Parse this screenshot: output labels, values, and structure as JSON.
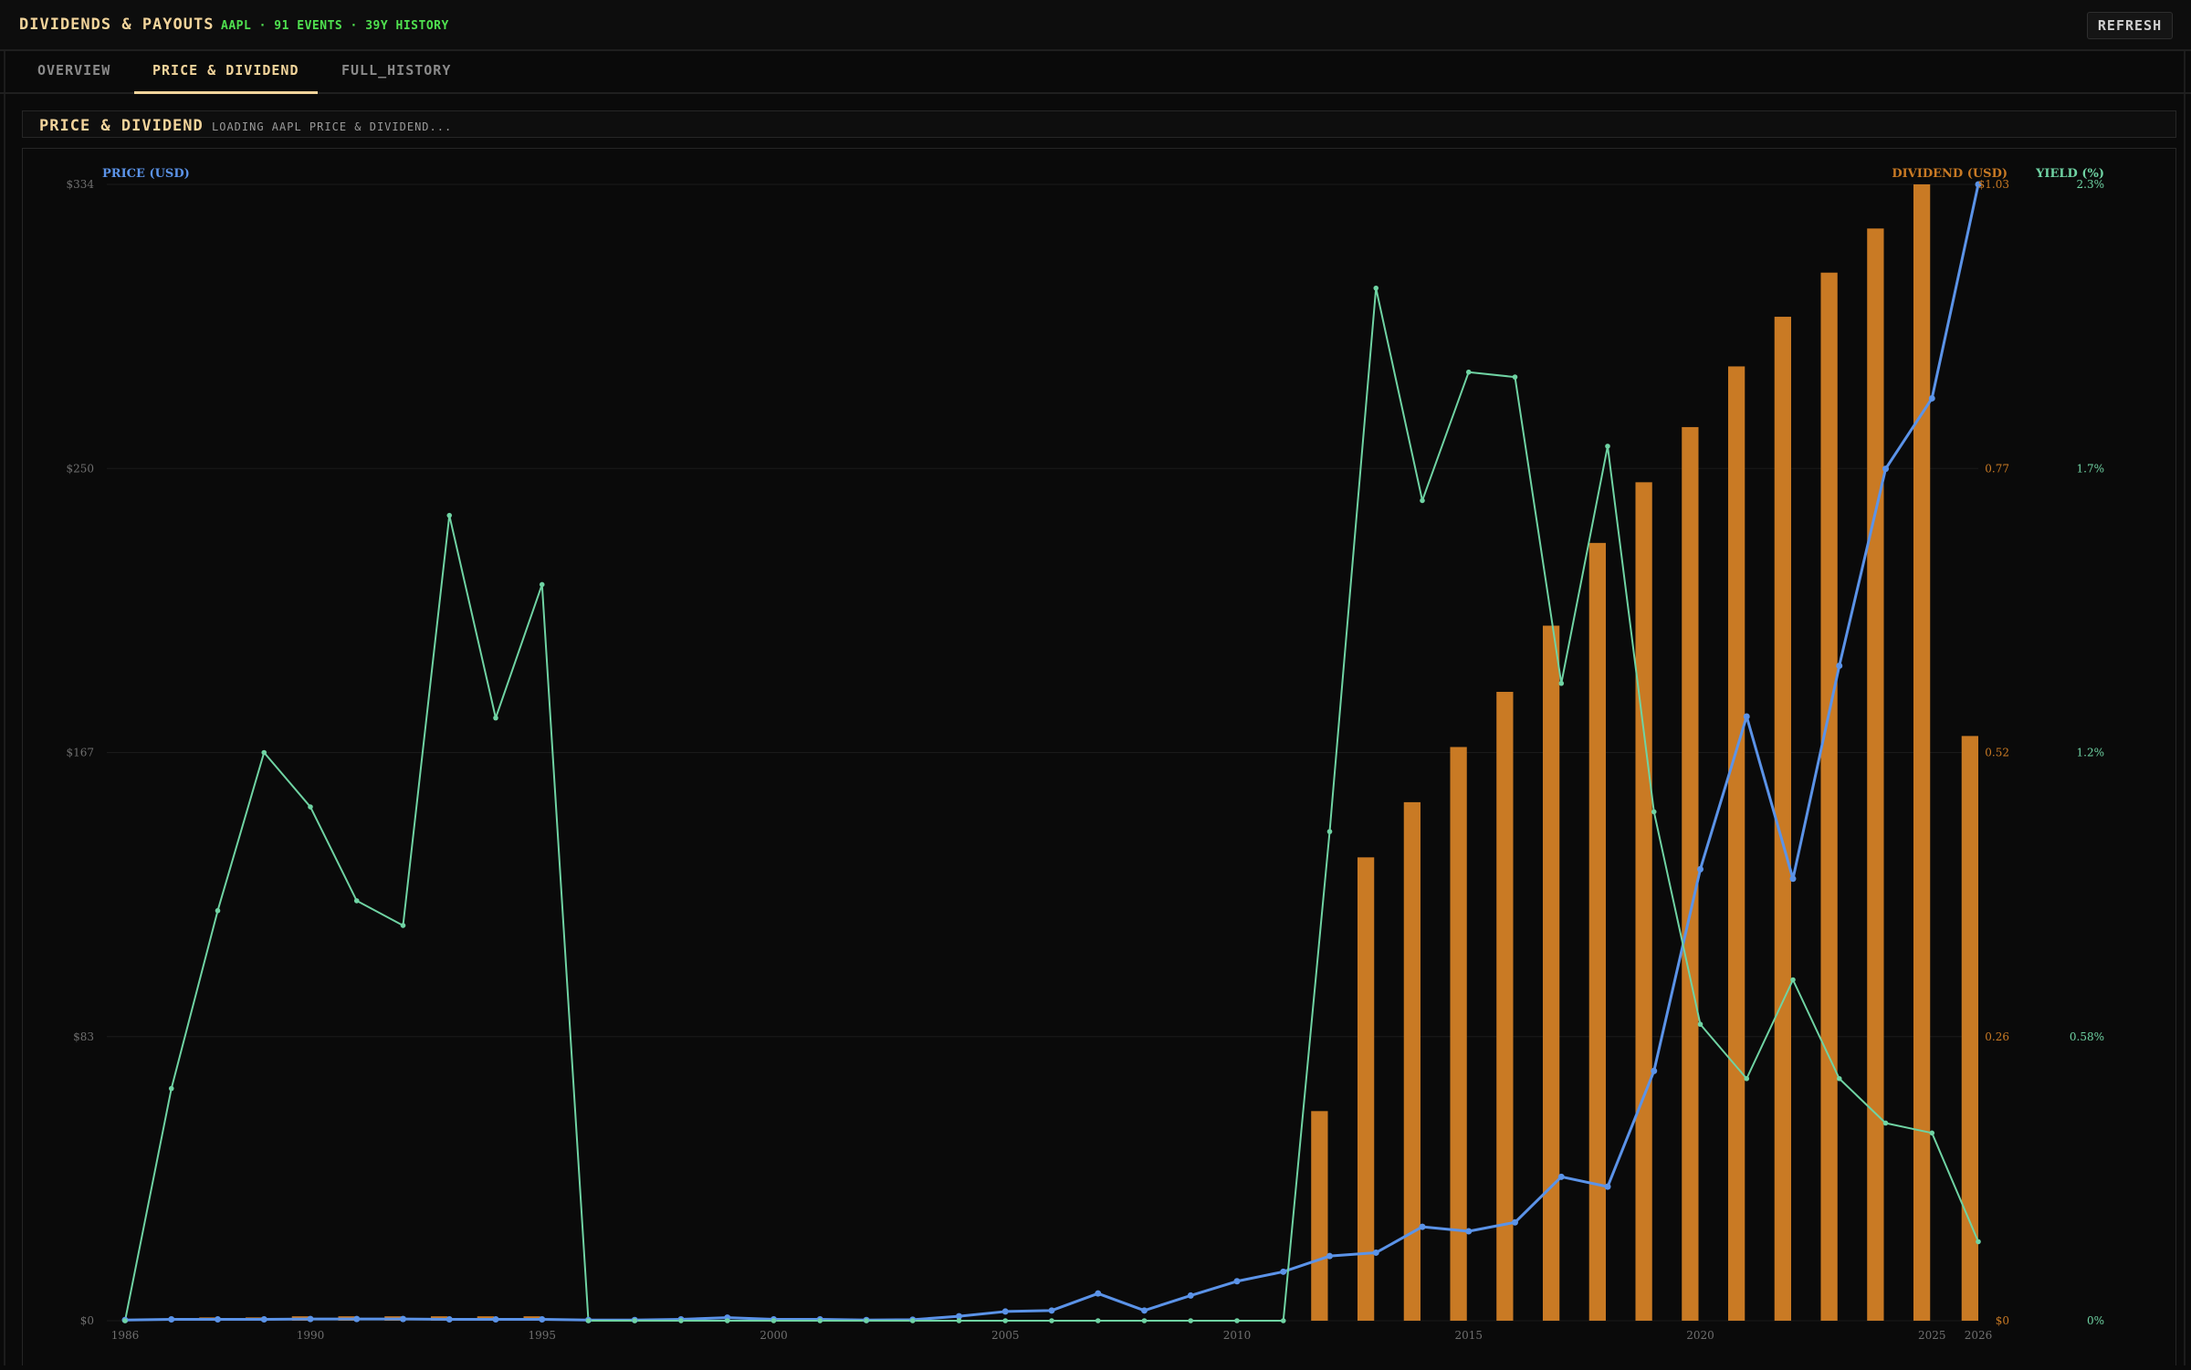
{
  "header": {
    "title": "DIVIDENDS & PAYOUTS",
    "meta": "AAPL · 91 EVENTS · 39Y HISTORY",
    "refresh_label": "REFRESH"
  },
  "tabs": [
    {
      "label": "OVERVIEW",
      "active": false
    },
    {
      "label": "PRICE & DIVIDEND",
      "active": true
    },
    {
      "label": "FULL_HISTORY",
      "active": false
    }
  ],
  "section": {
    "title": "PRICE & DIVIDEND",
    "status": "LOADING AAPL PRICE & DIVIDEND..."
  },
  "colors": {
    "price": "#5b93e8",
    "dividend": "#c97a24",
    "yield": "#6fd3a3",
    "accent": "#f2d49b",
    "meta_green": "#4fe04f"
  },
  "chart_data": {
    "type": "bar+line",
    "axes": {
      "price": {
        "label": "PRICE (USD)",
        "ticks": [
          "$0",
          "$83",
          "$167",
          "$250",
          "$334"
        ],
        "range": [
          0,
          334
        ]
      },
      "dividend": {
        "label": "DIVIDEND (USD)",
        "ticks": [
          "$0",
          "0.26",
          "0.52",
          "0.77",
          "$1.03"
        ],
        "range": [
          0,
          1.03
        ]
      },
      "yield": {
        "label": "YIELD (%)",
        "ticks": [
          "0%",
          "0.58%",
          "1.2%",
          "1.7%",
          "2.3%"
        ],
        "range": [
          0,
          2.3
        ]
      },
      "x": {
        "ticks": [
          "1986",
          "1990",
          "1995",
          "2000",
          "2005",
          "2010",
          "2015",
          "2020",
          "2025",
          "2026"
        ],
        "range": [
          1986,
          2026
        ]
      }
    },
    "grid": true,
    "years": [
      1986,
      1987,
      1988,
      1989,
      1990,
      1991,
      1992,
      1993,
      1994,
      1995,
      1996,
      1997,
      1998,
      1999,
      2000,
      2001,
      2002,
      2003,
      2004,
      2005,
      2006,
      2007,
      2008,
      2009,
      2010,
      2011,
      2012,
      2013,
      2014,
      2015,
      2016,
      2017,
      2018,
      2019,
      2020,
      2021,
      2022,
      2023,
      2024,
      2025,
      2026
    ],
    "series": [
      {
        "name": "DIVIDEND (USD)",
        "axis": "dividend",
        "kind": "bar",
        "values": [
          0,
          0,
          0.003,
          0.003,
          0.004,
          0.004,
          0.004,
          0.004,
          0.004,
          0.004,
          0,
          0,
          0,
          0,
          0,
          0,
          0,
          0,
          0,
          0,
          0,
          0,
          0,
          0,
          0,
          0,
          0.19,
          0.42,
          0.47,
          0.52,
          0.57,
          0.63,
          0.705,
          0.76,
          0.81,
          0.865,
          0.91,
          0.95,
          0.99,
          1.03,
          0.53
        ]
      },
      {
        "name": "PRICE (USD)",
        "axis": "price",
        "kind": "line",
        "values": [
          0.2,
          0.4,
          0.4,
          0.4,
          0.5,
          0.5,
          0.5,
          0.4,
          0.4,
          0.4,
          0.2,
          0.2,
          0.4,
          0.9,
          0.4,
          0.4,
          0.2,
          0.3,
          1.3,
          2.7,
          3.0,
          8.0,
          3.0,
          7.4,
          11.6,
          14.4,
          19.0,
          20.0,
          27.6,
          26.3,
          28.9,
          42.3,
          39.4,
          73.4,
          132.7,
          177.6,
          129.9,
          192.5,
          250.4,
          271.1,
          334.0
        ]
      },
      {
        "name": "YIELD (%)",
        "axis": "yield",
        "kind": "line",
        "values": [
          0,
          0.47,
          0.83,
          1.15,
          1.04,
          0.85,
          0.8,
          1.63,
          1.22,
          1.49,
          0,
          0,
          0,
          0,
          0,
          0,
          0,
          0,
          0,
          0,
          0,
          0,
          0,
          0,
          0,
          0,
          0.99,
          2.09,
          1.66,
          1.92,
          1.91,
          1.29,
          1.77,
          1.03,
          0.6,
          0.49,
          0.69,
          0.49,
          0.4,
          0.38,
          0.16
        ]
      }
    ]
  }
}
